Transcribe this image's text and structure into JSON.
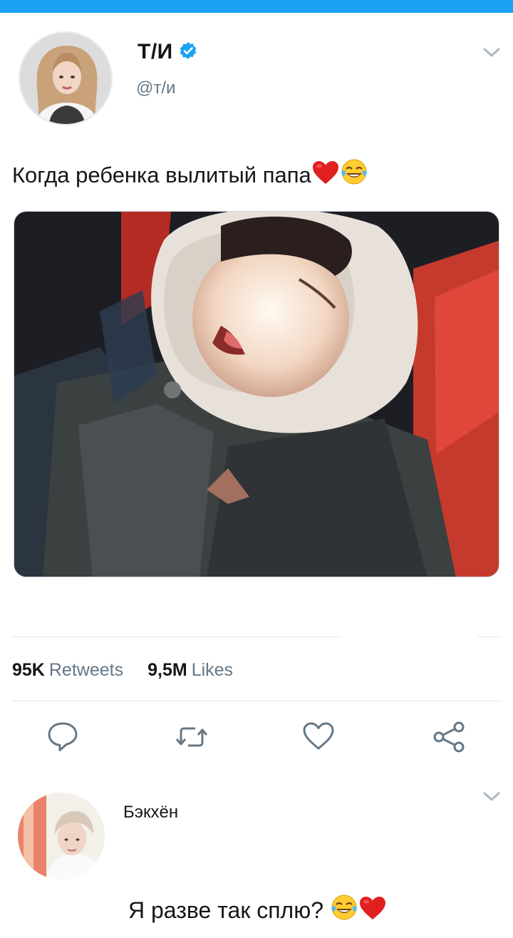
{
  "tweet": {
    "display_name": "Т/И",
    "handle": "@т/и",
    "text": "Когда ребенка вылитый папа",
    "text_emojis": [
      "heart",
      "tears-of-joy"
    ]
  },
  "stats": {
    "retweets_count": "95K",
    "retweets_label": "Retweets",
    "likes_count": "9,5M",
    "likes_label": "Likes"
  },
  "actions": [
    "reply-icon",
    "retweet-icon",
    "like-icon",
    "share-icon"
  ],
  "reply": {
    "display_name": "Бэкхён",
    "text": "Я разве так сплю?",
    "text_emojis": [
      "tears-of-joy",
      "heart"
    ]
  },
  "colors": {
    "accent": "#1da1f2",
    "secondary_text": "#657786",
    "icon": "#657786"
  }
}
